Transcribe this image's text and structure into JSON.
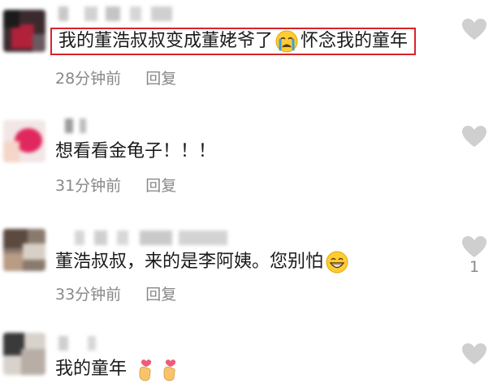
{
  "comments": [
    {
      "text_before": "我的董浩叔叔变成董姥爷了",
      "emoji": "crying-face-emoji",
      "text_after": "怀念我的童年",
      "time": "28分钟前",
      "reply_label": "回复",
      "likes": ""
    },
    {
      "text_before": "想看看金龟子！！！",
      "emoji": "",
      "text_after": "",
      "time": "31分钟前",
      "reply_label": "回复",
      "likes": ""
    },
    {
      "text_before": "董浩叔叔，来的是李阿姨。您别怕",
      "emoji": "grinning-face-emoji",
      "text_after": "",
      "time": "33分钟前",
      "reply_label": "回复",
      "likes": "1"
    },
    {
      "text_before": "我的童年",
      "emoji": "finger-heart-emoji",
      "text_after": "",
      "time": "",
      "reply_label": "",
      "likes": ""
    }
  ],
  "colors": {
    "highlight_border": "#d8242a",
    "meta_text": "#888888",
    "heart": "#cfcfcf"
  }
}
